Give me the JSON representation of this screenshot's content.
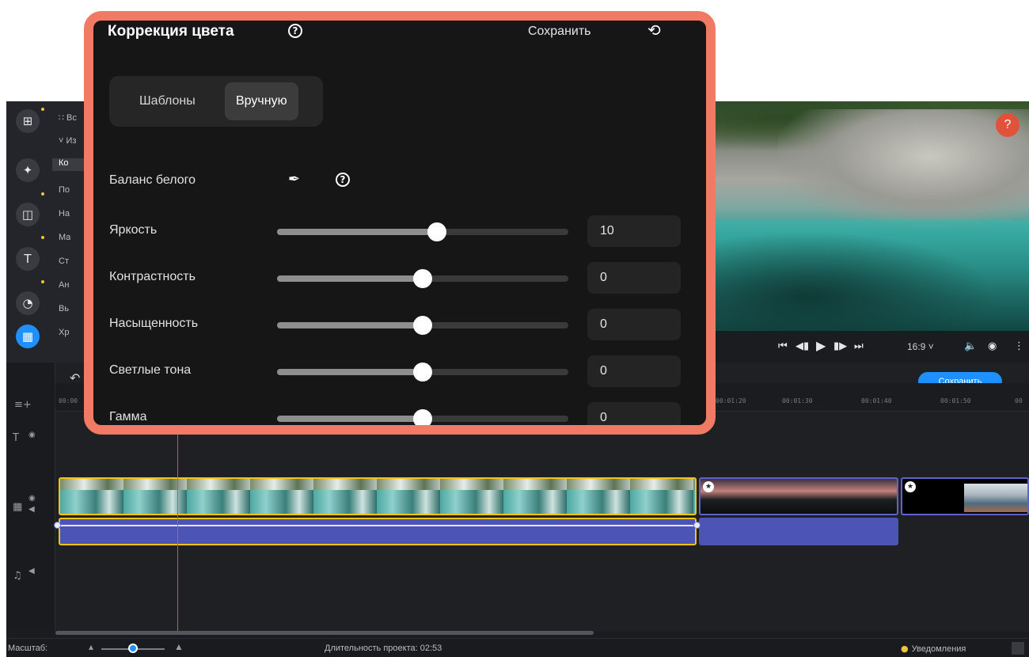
{
  "left_toolbar": {
    "tools": [
      "import-icon",
      "magic-wand-icon",
      "transitions-icon",
      "titles-icon",
      "stickers-icon",
      "more-tools-icon"
    ],
    "accent_color": "#1e90ff"
  },
  "categories": {
    "items": [
      "∷ Вс",
      "˅ Из",
      "Ко",
      "По",
      "На",
      "Ма",
      "Ст",
      "Ан",
      "Вь",
      "Хр"
    ]
  },
  "preview": {
    "help_label": "?"
  },
  "player": {
    "aspect_ratio": "16:9 ˅"
  },
  "timeline": {
    "save_button": "Сохранить",
    "ticks": [
      "00:00",
      "00:01:20",
      "00:01:30",
      "00:01:40",
      "00:01:50",
      "00"
    ]
  },
  "status_bar": {
    "zoom_label": "Масштаб:",
    "zoom_level": 0.5,
    "duration": "Длительность проекта: 02:53",
    "notifications": "Уведомления"
  },
  "color_correction": {
    "title": "Коррекция цвета",
    "help_symbol": "?",
    "save_label": "Сохранить",
    "tabs": [
      {
        "label": "Шаблоны",
        "active": false
      },
      {
        "label": "Вручную",
        "active": true
      }
    ],
    "white_balance_label": "Баланс белого",
    "sliders": [
      {
        "label": "Яркость",
        "value": "10",
        "level": 0.55
      },
      {
        "label": "Контрастность",
        "value": "0",
        "level": 0.5
      },
      {
        "label": "Насыщенность",
        "value": "0",
        "level": 0.5
      },
      {
        "label": "Светлые тона",
        "value": "0",
        "level": 0.5
      },
      {
        "label": "Гамма",
        "value": "0",
        "level": 0.5
      }
    ]
  }
}
